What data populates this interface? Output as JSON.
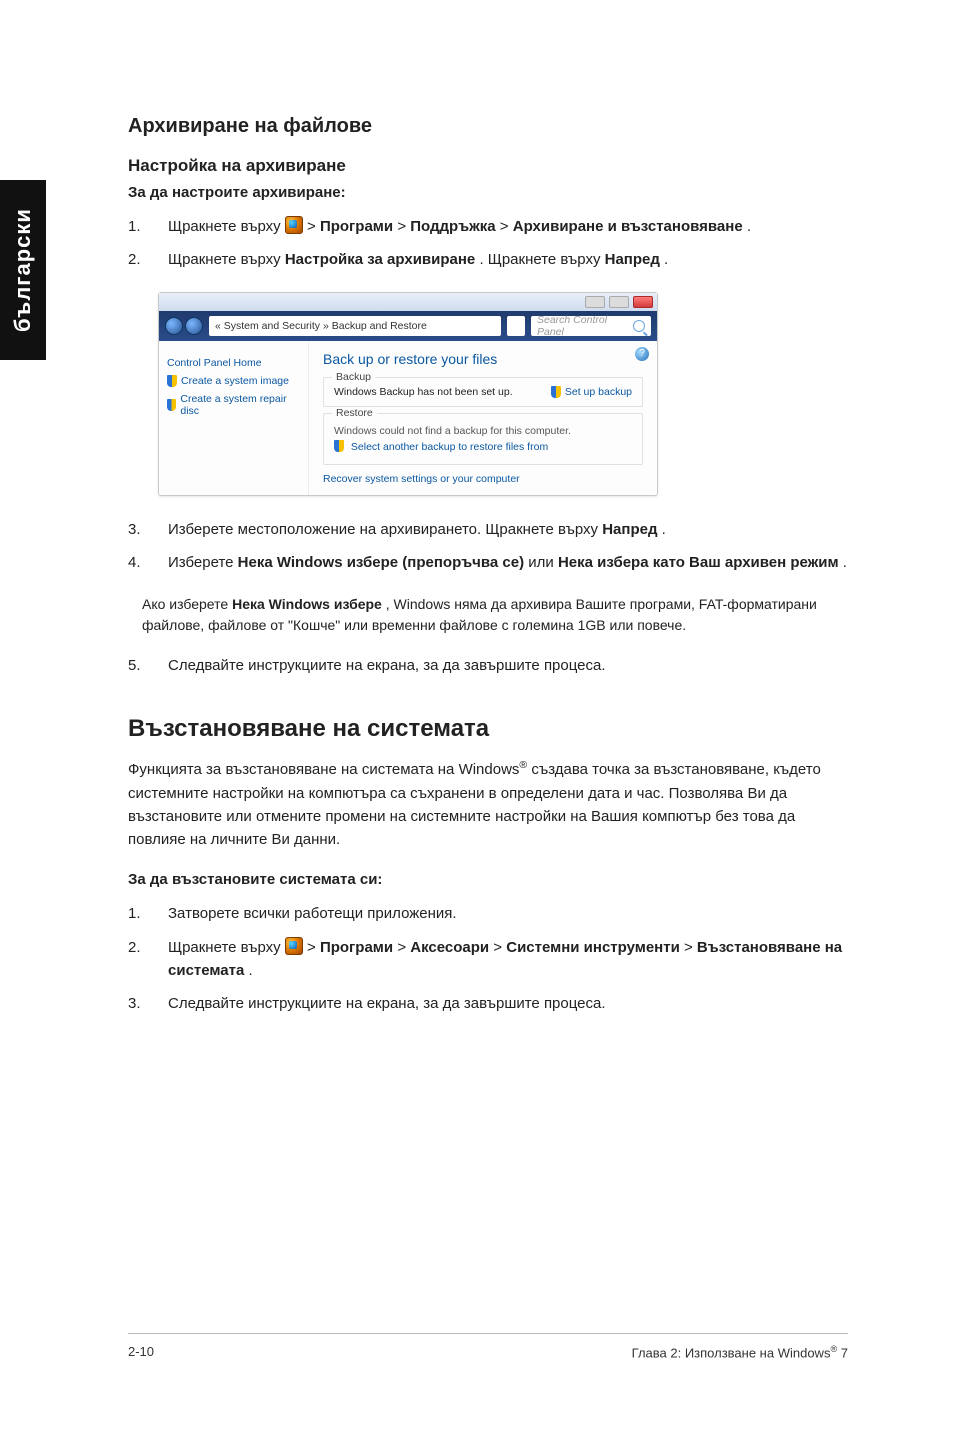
{
  "sidebar": {
    "language": "български"
  },
  "section1": {
    "title": "Архивиране на файлове",
    "subtitle": "Настройка на архивиране",
    "lead": "За да настроите архивиране:",
    "steps": {
      "s1_a": "Щракнете върху ",
      "s1_b": " > ",
      "s1_c": "Програми",
      "s1_d": " > ",
      "s1_e": "Поддръжка",
      "s1_f": " > ",
      "s1_g": "Архивиране и възстановяване",
      "s1_end": ".",
      "s2_a": "Щракнете върху ",
      "s2_b": "Настройка за архивиране",
      "s2_c": ". Щракнете върху ",
      "s2_d": "Напред",
      "s2_e": ".",
      "s3_a": "Изберете местоположение на архивирането. Щракнете върху ",
      "s3_b": "Напред",
      "s3_c": ".",
      "s4_a": "Изберете ",
      "s4_b": "Нека Windows избере (препоръчва се)",
      "s4_c": " или ",
      "s4_d": "Нека избера като Ваш архивен режим",
      "s4_e": ".",
      "s5": "Следвайте инструкциите на екрана, за да завършите процеса."
    }
  },
  "screenshot": {
    "breadcrumb": "« System and Security » Backup and Restore",
    "search_placeholder": "Search Control Panel",
    "side": {
      "home": "Control Panel Home",
      "link1": "Create a system image",
      "link2": "Create a system repair disc"
    },
    "main_title": "Back up or restore your files",
    "group_backup": {
      "label": "Backup",
      "status": "Windows Backup has not been set up.",
      "action": "Set up backup"
    },
    "group_restore": {
      "label": "Restore",
      "line1": "Windows could not find a backup for this computer.",
      "line2": "Select another backup to restore files from"
    },
    "recover": "Recover system settings or your computer"
  },
  "note": {
    "text_a": "Ако изберете ",
    "text_b": "Нека Windows избере",
    "text_c": ", Windows няма да архивира Вашите програми, FAT-форматирани файлове, файлове от \"Кошче\" или временни файлове с големина 1GB или повече."
  },
  "section2": {
    "title": "Възстановяване на системата",
    "para_a": "Функцията за възстановяване на системата на Windows",
    "para_b": " създава точка за възстановяване, където системните настройки на компютъра са съхранени в определени дата и час. Позволява Ви да възстановите или отмените промени на системните настройки на Вашия компютър без това да повлияе на личните Ви данни.",
    "lead": "За да възстановите системата си:",
    "steps": {
      "r1": "Затворете всички работещи приложения.",
      "r2_a": "Щракнете върху ",
      "r2_b": " > ",
      "r2_c": "Програми",
      "r2_d": " > ",
      "r2_e": "Аксесоари",
      "r2_f": " > ",
      "r2_g": "Системни инструменти",
      "r2_h": " > ",
      "r2_i": "Възстановяване на системата",
      "r2_j": ".",
      "r3": "Следвайте инструкциите на екрана, за да завършите процеса."
    }
  },
  "footer": {
    "left": "2-10",
    "right_a": "Глава 2: Използване на Windows",
    "right_b": " 7"
  }
}
